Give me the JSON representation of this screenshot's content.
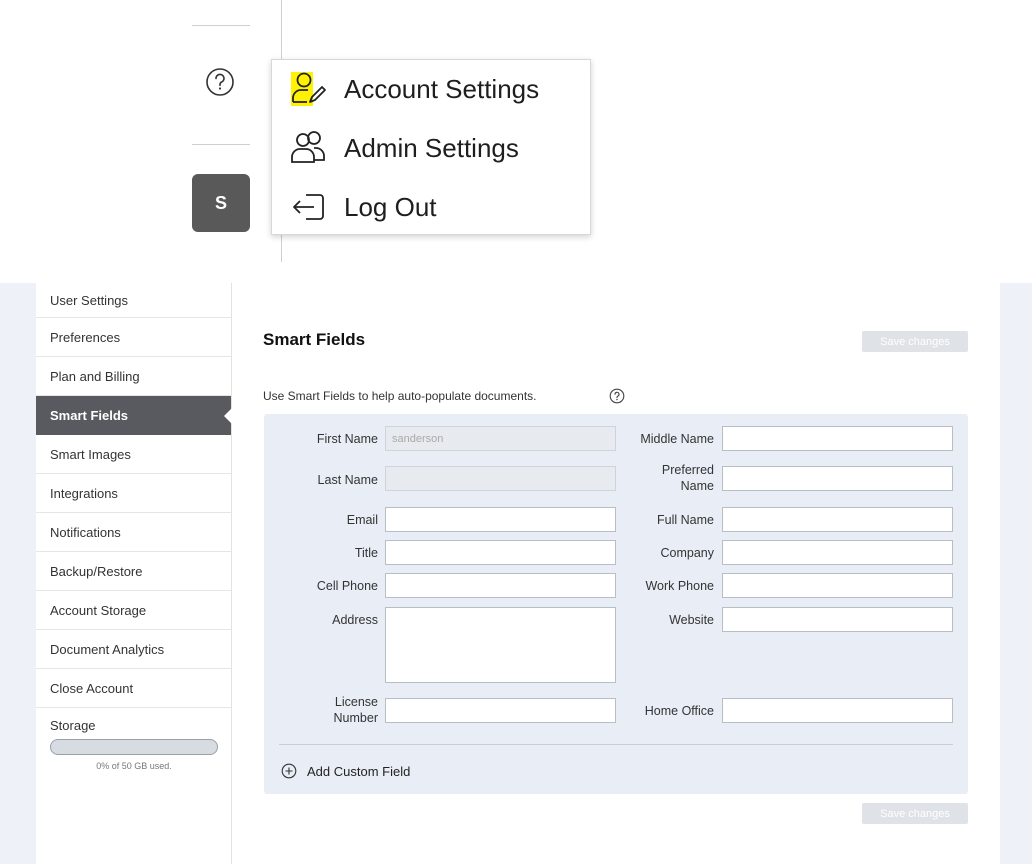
{
  "avatar": {
    "initial": "S"
  },
  "user_menu": {
    "items": [
      {
        "label": "Account Settings",
        "icon": "user-edit-icon"
      },
      {
        "label": "Admin Settings",
        "icon": "users-icon"
      },
      {
        "label": "Log Out",
        "icon": "logout-icon"
      }
    ]
  },
  "sidebar": {
    "items": [
      "User Settings",
      "Preferences",
      "Plan and Billing",
      "Smart Fields",
      "Smart Images",
      "Integrations",
      "Notifications",
      "Backup/Restore",
      "Account Storage",
      "Document Analytics",
      "Close Account"
    ],
    "active": "Smart Fields",
    "storage": {
      "label": "Storage",
      "note": "0% of 50 GB used.",
      "used_percent": 0
    }
  },
  "content": {
    "title": "Smart Fields",
    "save_label": "Save changes",
    "description": "Use Smart Fields to help auto-populate documents.",
    "fields": {
      "first_name": {
        "label": "First Name",
        "value": "sanderson"
      },
      "middle_name": {
        "label": "Middle Name",
        "value": ""
      },
      "last_name": {
        "label": "Last Name",
        "value": ""
      },
      "preferred_name": {
        "label_1": "Preferred",
        "label_2": "Name",
        "value": ""
      },
      "email": {
        "label": "Email",
        "value": ""
      },
      "full_name": {
        "label": "Full Name",
        "value": ""
      },
      "title": {
        "label": "Title",
        "value": ""
      },
      "company": {
        "label": "Company",
        "value": ""
      },
      "cell_phone": {
        "label": "Cell Phone",
        "value": ""
      },
      "work_phone": {
        "label": "Work Phone",
        "value": ""
      },
      "address": {
        "label": "Address",
        "value": ""
      },
      "website": {
        "label": "Website",
        "value": ""
      },
      "license_number": {
        "label_1": "License",
        "label_2": "Number",
        "value": ""
      },
      "home_office": {
        "label": "Home Office",
        "value": ""
      }
    },
    "add_custom_field": "Add Custom Field"
  },
  "colors": {
    "highlight": "#fff200",
    "active_tab": "#585a60",
    "form_panel": "#e9eef6",
    "save_button": "#dfe2e6"
  }
}
